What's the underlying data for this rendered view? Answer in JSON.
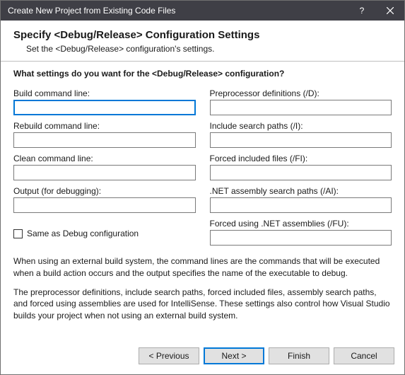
{
  "window": {
    "title": "Create New Project from Existing Code Files"
  },
  "header": {
    "title": "Specify <Debug/Release> Configuration Settings",
    "subtitle": "Set the <Debug/Release> configuration's settings."
  },
  "question": "What settings do you want for the <Debug/Release> configuration?",
  "fields": {
    "build_cmd": {
      "label": "Build command line:",
      "value": ""
    },
    "rebuild_cmd": {
      "label": "Rebuild command line:",
      "value": ""
    },
    "clean_cmd": {
      "label": "Clean command line:",
      "value": ""
    },
    "output": {
      "label": "Output (for debugging):",
      "value": ""
    },
    "preproc": {
      "label": "Preprocessor definitions (/D):",
      "value": ""
    },
    "include": {
      "label": "Include search paths (/I):",
      "value": ""
    },
    "forced_inc": {
      "label": "Forced included files (/FI):",
      "value": ""
    },
    "net_search": {
      "label": ".NET assembly search paths (/AI):",
      "value": ""
    },
    "forced_using": {
      "label": "Forced using .NET assemblies (/FU):",
      "value": ""
    }
  },
  "checkbox": {
    "same_as_debug": "Same as Debug configuration"
  },
  "notes": {
    "n1": "When using an external build system, the command lines are the commands that will be executed when a build action occurs and the output specifies the name of the executable to debug.",
    "n2": "The preprocessor definitions, include search paths, forced included files, assembly search paths, and forced using assemblies are used for IntelliSense.  These settings also control how Visual Studio builds your project when not using an external build system."
  },
  "buttons": {
    "previous": "< Previous",
    "next": "Next >",
    "finish": "Finish",
    "cancel": "Cancel"
  }
}
